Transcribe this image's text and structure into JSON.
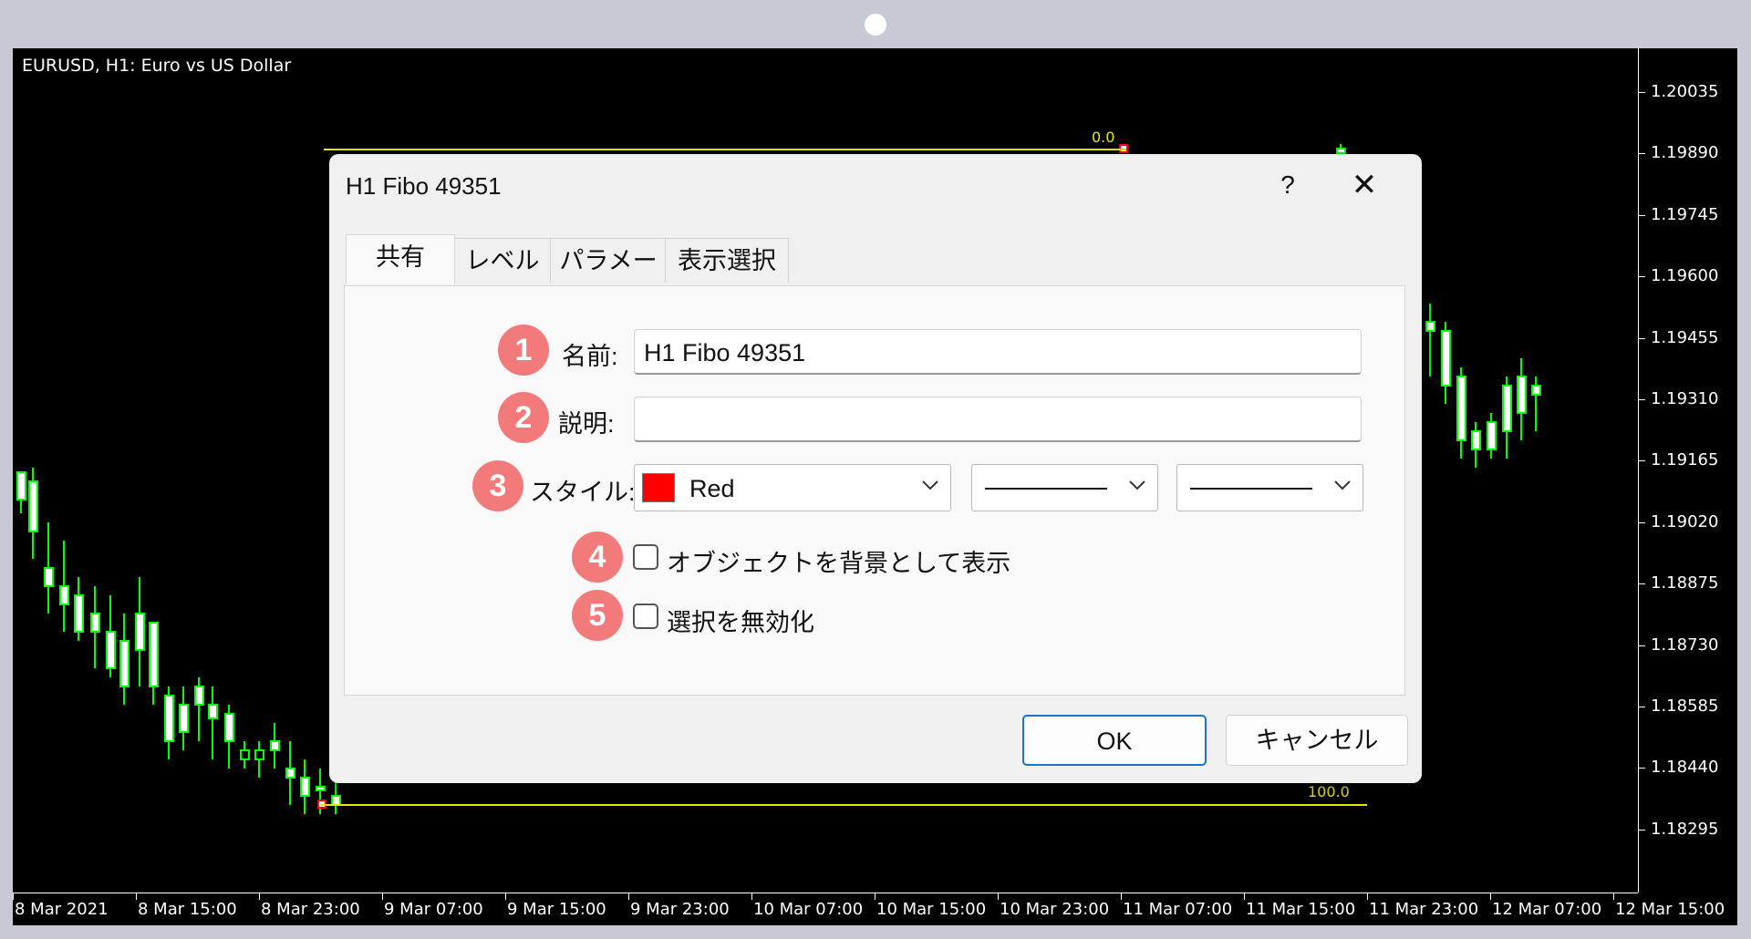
{
  "chart": {
    "title": "EURUSD, H1:  Euro vs US Dollar",
    "price_labels": [
      "1.20035",
      "1.19890",
      "1.19745",
      "1.19600",
      "1.19455",
      "1.19310",
      "1.19165",
      "1.19020",
      "1.18875",
      "1.18730",
      "1.18585",
      "1.18440",
      "1.18295"
    ],
    "time_labels": [
      "8 Mar 2021",
      "8 Mar 15:00",
      "8 Mar 23:00",
      "9 Mar 07:00",
      "9 Mar 15:00",
      "9 Mar 23:00",
      "10 Mar 07:00",
      "10 Mar 15:00",
      "10 Mar 23:00",
      "11 Mar 07:00",
      "11 Mar 15:00",
      "11 Mar 23:00",
      "12 Mar 07:00",
      "12 Mar 15:00"
    ],
    "fibo_top_label": "0.0",
    "fibo_bottom_label": "100.0",
    "colors": {
      "background": "#000000",
      "candle": "#00ff00",
      "fibo": "#e8e800",
      "anchor": "#ff0000"
    }
  },
  "dialog": {
    "title": "H1 Fibo 49351",
    "help_label": "?",
    "close_label": "✕",
    "tabs": [
      {
        "label": "共有",
        "active": true
      },
      {
        "label": "レベル",
        "active": false
      },
      {
        "label": "パラメータ",
        "active": false
      },
      {
        "label": "表示選択",
        "active": false
      }
    ],
    "badges": [
      "1",
      "2",
      "3",
      "4",
      "5"
    ],
    "name_label": "名前:",
    "name_value": "H1 Fibo 49351",
    "desc_label": "説明:",
    "desc_value": "",
    "style_label": "スタイル:",
    "color_value": "Red",
    "color_swatch": "#ff0000",
    "background_checkbox_label": "オブジェクトを背景として表示",
    "disable_select_checkbox_label": "選択を無効化",
    "ok_label": "OK",
    "cancel_label": "キャンセル"
  }
}
